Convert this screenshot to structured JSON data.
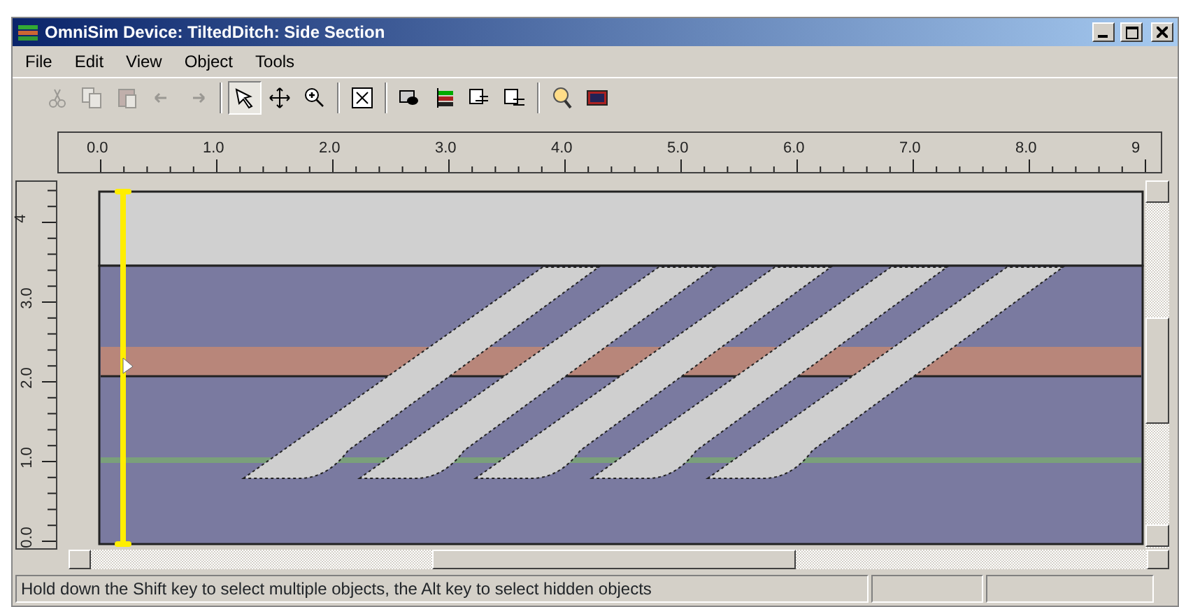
{
  "window": {
    "title": "OmniSim Device: TiltedDitch: Side Section"
  },
  "menu": [
    "File",
    "Edit",
    "View",
    "Object",
    "Tools"
  ],
  "toolbar": [
    [
      {
        "disabled": true,
        "selected": false
      },
      {
        "disabled": true,
        "selected": false
      },
      {
        "disabled": true,
        "selected": false
      },
      {
        "disabled": true,
        "selected": false
      },
      {
        "disabled": true,
        "selected": false
      }
    ],
    [
      {
        "disabled": false,
        "selected": true
      },
      {
        "disabled": false,
        "selected": false
      },
      {
        "disabled": false,
        "selected": false
      }
    ],
    [
      {
        "disabled": false,
        "selected": false
      }
    ],
    [
      {
        "disabled": false,
        "selected": false
      },
      {
        "disabled": false,
        "selected": false
      },
      {
        "disabled": false,
        "selected": false
      },
      {
        "disabled": false,
        "selected": false
      }
    ],
    [
      {
        "disabled": false,
        "selected": false
      },
      {
        "disabled": false,
        "selected": false
      }
    ]
  ],
  "top_ruler": [
    "0.0",
    "1.0",
    "2.0",
    "3.0",
    "4.0",
    "5.0",
    "6.0",
    "7.0",
    "8.0",
    "9"
  ],
  "left_ruler": [
    "0.0",
    "1.0",
    "2.0",
    "3.0",
    "4"
  ],
  "status_bar": {
    "text": "Hold down the Shift key to select multiple objects, the Alt key to select hidden objects"
  }
}
